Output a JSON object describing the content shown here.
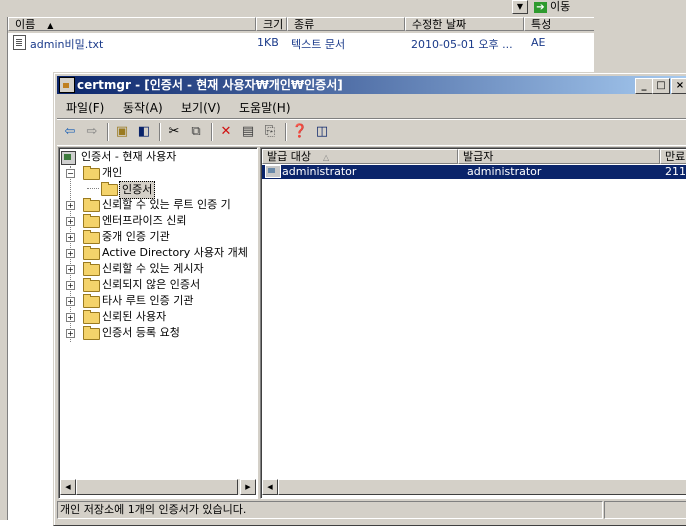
{
  "background_window": {
    "go_label": "이동",
    "columns": [
      "이름",
      "크기",
      "종류",
      "수정한 날짜",
      "특성"
    ],
    "file": {
      "name": "admin비밀.txt",
      "size": "1KB",
      "type": "텍스트 문서",
      "modified": "2010-05-01 오후 ...",
      "attributes": "AE"
    }
  },
  "window": {
    "title": "certmgr - [인증서 - 현재 사용자₩개인₩인증서]",
    "controls": [
      "_",
      "□",
      "×"
    ]
  },
  "menu": [
    "파일(F)",
    "동작(A)",
    "보기(V)",
    "도움말(H)"
  ],
  "toolbar_icons": [
    "back-arrow-icon",
    "forward-arrow-icon",
    "up-folder-icon",
    "show-hide-tree-icon",
    "cut-icon",
    "copy-icon",
    "delete-icon",
    "properties-icon",
    "refresh-icon",
    "export-list-icon",
    "help-icon",
    "console-icon"
  ],
  "tree": {
    "root": "인증서 - 현재 사용자",
    "personal": "개인",
    "personal_child": "인증서",
    "items": [
      "신뢰할 수 있는 루트 인증 기",
      "엔터프라이즈 신뢰",
      "중개 인증 기관",
      "Active Directory 사용자 개체",
      "신뢰할 수 있는 게시자",
      "신뢰되지 않은 인증서",
      "타사 루트 인증 기관",
      "신뢰된 사용자",
      "인증서 등록 요청"
    ]
  },
  "list": {
    "columns": [
      "발급 대상",
      "발급자",
      "만료"
    ],
    "rows": [
      {
        "issued_to": "administrator",
        "issued_by": "administrator",
        "expiry": "211"
      }
    ]
  },
  "status": "개인 저장소에 1개의 인증서가 있습니다."
}
